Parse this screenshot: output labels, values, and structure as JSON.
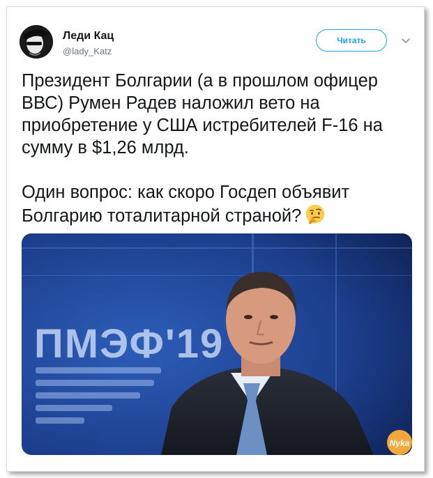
{
  "author": {
    "name": "Леди Кац",
    "handle": "@lady_Katz"
  },
  "follow_button": {
    "label": "Читать"
  },
  "tweet": {
    "paragraph1": "Президент Болгарии (а в прошлом офицер ВВС) Румен Радев наложил вето на приобретение у США истребителей F-16 на сумму в $1,26 млрд.",
    "paragraph2": "Один вопрос: как скоро Госдеп объявит Болгарию тоталитарной страной?",
    "emoji": "thinking-face-emoji"
  },
  "photo": {
    "sign_text": "ПМЭФ'19",
    "watermark": "Nyka"
  },
  "colors": {
    "accent": "#1da1f2",
    "text": "#14171a",
    "muted": "#657786",
    "photo_bg": "#1c3e8c"
  }
}
